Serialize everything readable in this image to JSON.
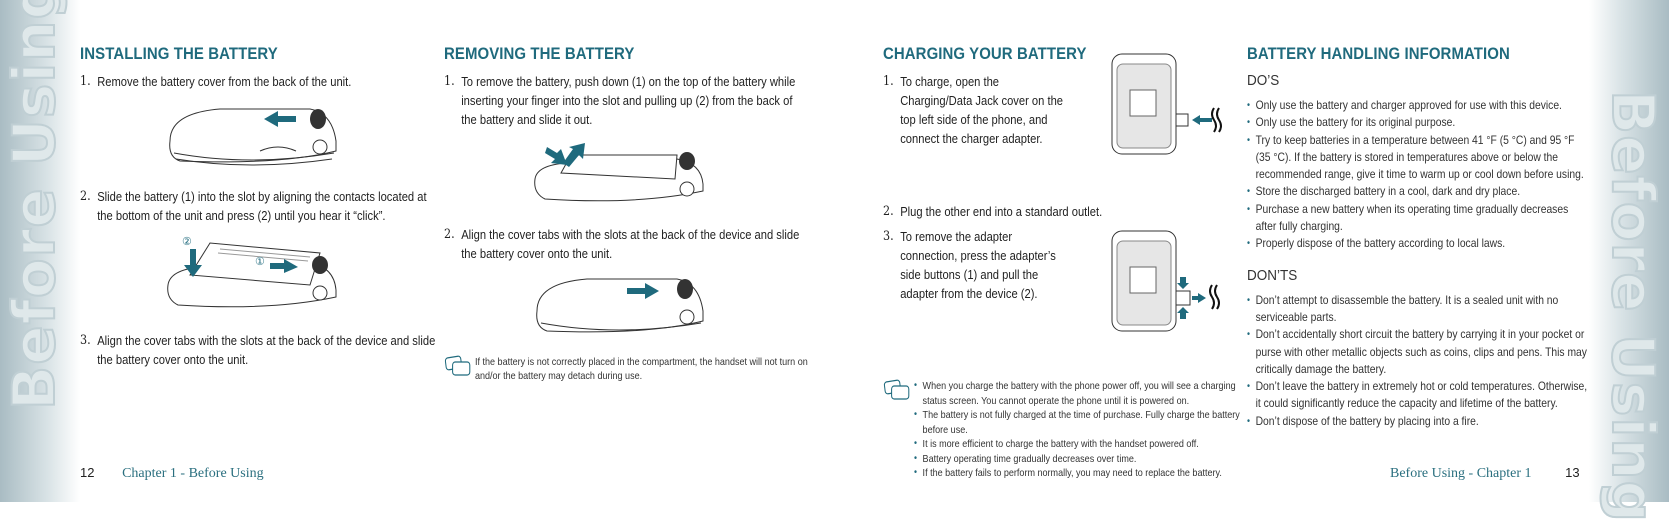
{
  "side_tab": {
    "left_label": "Before Using",
    "right_label": "Before Using"
  },
  "installing": {
    "title": "INSTALLING THE BATTERY",
    "steps": [
      {
        "num": "1.",
        "text": "Remove the battery cover from the back of the unit."
      },
      {
        "num": "2.",
        "text": "Slide the battery (1) into the slot by aligning the contacts located at the bottom of the unit and press (2) until you hear it “click”."
      },
      {
        "num": "3.",
        "text": "Align the cover tabs with the slots at the back of the device and slide the battery cover onto the unit."
      }
    ],
    "figure_labels": {
      "one": "①",
      "two": "②"
    }
  },
  "removing": {
    "title": "REMOVING THE BATTERY",
    "steps": [
      {
        "num": "1.",
        "text": "To remove the battery, push down (1) on the top of the battery while inserting your finger into the slot and pulling up (2) from the back of the battery and slide it out."
      },
      {
        "num": "2.",
        "text": "Align the cover tabs with the slots at the back of the device and slide the battery cover onto the unit."
      }
    ],
    "note": "If the battery is not correctly placed in the compartment, the handset will not turn on and/or the battery may detach during use."
  },
  "charging": {
    "title": "CHARGING YOUR BATTERY",
    "steps": [
      {
        "num": "1.",
        "text": "To charge, open the Charging/Data Jack cover on the top left side of the phone, and connect the charger adapter."
      },
      {
        "num": "2.",
        "text": "Plug the other end into a standard outlet."
      },
      {
        "num": "3.",
        "text": "To remove the adapter connection, press the adapter’s side buttons (1) and pull the adapter from the device (2)."
      }
    ],
    "notes": [
      "When you charge the battery with the phone power off, you will see a charging status screen. You cannot operate the phone until it is powered on.",
      "The battery is not fully charged at the time of purchase. Fully charge the battery before use.",
      "It is more efficient to charge the battery with the handset powered off.",
      "Battery operating time gradually decreases over time.",
      "If the battery fails to perform normally, you may need to replace the battery."
    ]
  },
  "handling": {
    "title": "BATTERY HANDLING INFORMATION",
    "dos_title": "DO’S",
    "dos": [
      "Only use the battery and charger approved for use with this device.",
      "Only use the battery for its original purpose.",
      "Try to keep batteries in a temperature between 41 °F (5 °C) and 95 °F (35 °C). If the battery is stored in temperatures above or below the recommended range, give it time to warm up or cool down before using.",
      "Store the discharged battery in a cool, dark and dry place.",
      "Purchase a new battery when its operating time gradually decreases after fully charging.",
      "Properly dispose of the battery according to local laws."
    ],
    "donts_title": "DON’TS",
    "donts": [
      "Don’t attempt to disassemble the battery. It is a sealed unit with no serviceable parts.",
      "Don’t accidentally short circuit the battery by carrying it in your pocket or purse with other metallic objects such as coins, clips and pens. This may critically damage the battery.",
      "Don’t leave the battery in extremely hot or cold temperatures. Otherwise, it could significantly reduce the capacity and lifetime of the battery.",
      "Don’t dispose of the battery by placing into a fire."
    ]
  },
  "footer": {
    "left_page": "12",
    "left_chapter": "Chapter 1 - Before Using",
    "right_chapter": "Before Using - Chapter 1",
    "right_page": "13"
  },
  "colors": {
    "accent": "#1f6a7d",
    "chapter": "#2a6f7f"
  }
}
